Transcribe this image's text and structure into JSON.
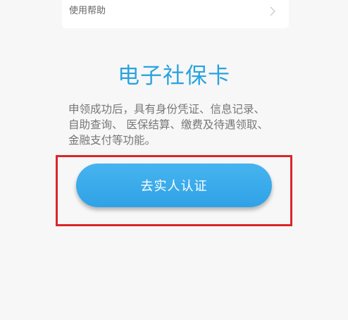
{
  "help": {
    "label": "使用帮助",
    "icon": "chevron-right-icon"
  },
  "card": {
    "title": "电子社保卡",
    "description_lines": [
      "申领成功后，具有身份凭证、信息记录、",
      "自助查询、 医保结算、缴费及待遇领取、",
      "金融支付等功能。"
    ]
  },
  "cta": {
    "label": "去实人认证"
  },
  "colors": {
    "accent": "#2aa3e0",
    "button": "#3aabea",
    "highlight_border": "#d9262b",
    "background": "#f7f7f7"
  }
}
